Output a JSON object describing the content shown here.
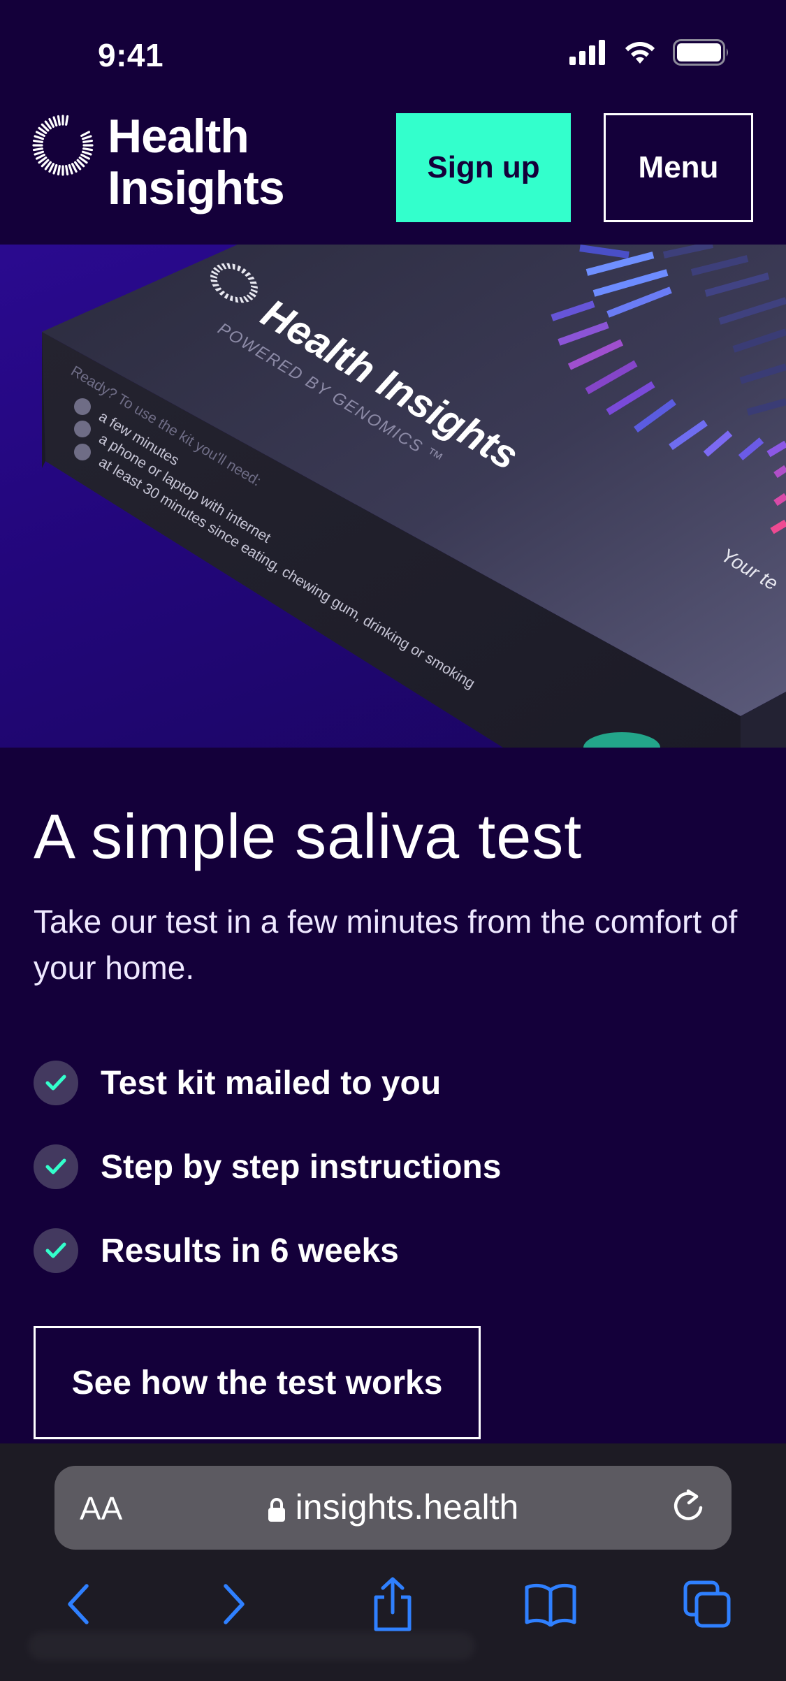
{
  "status_bar": {
    "time": "9:41"
  },
  "header": {
    "brand_line1": "Health",
    "brand_line2": "Insights",
    "signup_label": "Sign up",
    "menu_label": "Menu"
  },
  "hero": {
    "box_brand": "Health Insights",
    "box_tagline": "POWERED BY GENOMICS ™",
    "box_ready": "Ready? To use the kit you'll need:",
    "box_items": [
      "a few minutes",
      "a phone or laptop with internet",
      "at least 30 minutes since eating, chewing gum, drinking or smoking"
    ],
    "box_corner": "Your te"
  },
  "main": {
    "title": "A simple saliva test",
    "subtitle": "Take our test in a few minutes from the comfort of your home.",
    "features": [
      {
        "label": "Test kit mailed to you"
      },
      {
        "label": "Step by step instructions"
      },
      {
        "label": "Results in 6 weeks"
      }
    ],
    "cta_label": "See how the test works"
  },
  "browser": {
    "aa_label": "AA",
    "url": "insights.health"
  },
  "colors": {
    "background": "#14003a",
    "accent": "#33ffcc",
    "browser_blue": "#2f80ff"
  }
}
